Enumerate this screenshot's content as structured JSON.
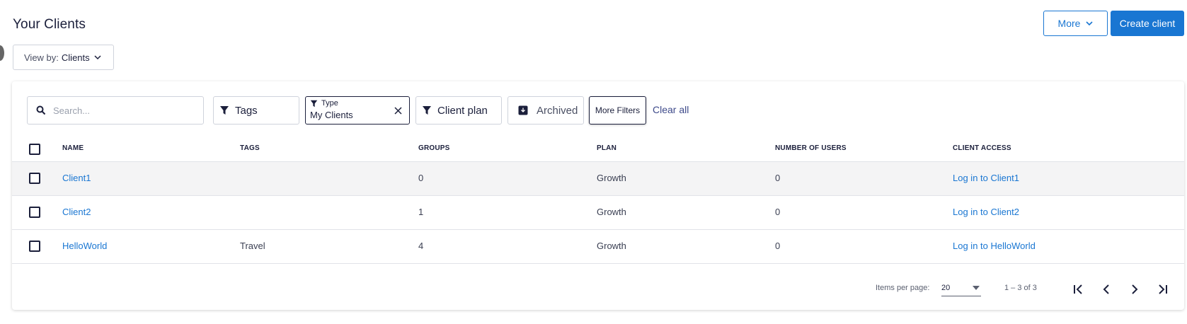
{
  "header": {
    "title": "Your Clients",
    "view_by_label": "View by:",
    "view_by_value": "Clients",
    "more_label": "More",
    "create_label": "Create client"
  },
  "filters": {
    "search_placeholder": "Search...",
    "tags_label": "Tags",
    "type_label": "Type",
    "type_value": "My Clients",
    "plan_label": "Client plan",
    "archived_label": "Archived",
    "more_filters_label": "More Filters",
    "clear_all_label": "Clear all"
  },
  "table": {
    "columns": [
      "NAME",
      "TAGS",
      "GROUPS",
      "PLAN",
      "NUMBER OF USERS",
      "CLIENT ACCESS"
    ],
    "rows": [
      {
        "name": "Client1",
        "tags": "",
        "groups": "0",
        "plan": "Growth",
        "users": "0",
        "access": "Log in to Client1"
      },
      {
        "name": "Client2",
        "tags": "",
        "groups": "1",
        "plan": "Growth",
        "users": "0",
        "access": "Log in to Client2"
      },
      {
        "name": "HelloWorld",
        "tags": "Travel",
        "groups": "4",
        "plan": "Growth",
        "users": "0",
        "access": "Log in to HelloWorld"
      }
    ]
  },
  "pagination": {
    "items_per_page_label": "Items per page:",
    "items_per_page_value": "20",
    "range_label": "1 – 3 of 3"
  },
  "colors": {
    "accent": "#1976d2",
    "text_dark": "#1b1f3b"
  }
}
